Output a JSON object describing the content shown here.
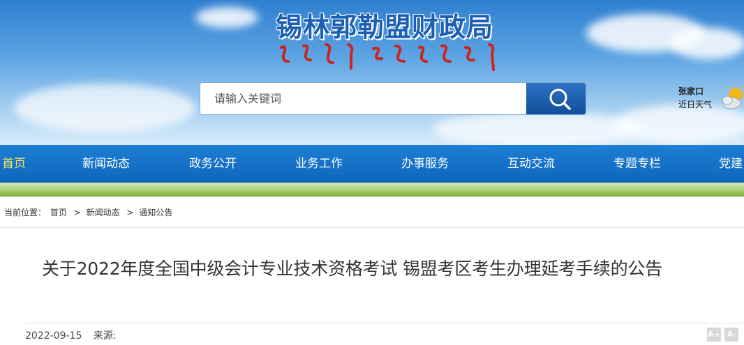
{
  "site": {
    "title": "锡林郭勒盟财政局"
  },
  "search": {
    "placeholder": "请输入关键词"
  },
  "weather": {
    "city": "张家口",
    "label": "近日天气",
    "icon": "partly-cloudy-icon"
  },
  "nav": {
    "items": [
      {
        "label": "首页",
        "active": true
      },
      {
        "label": "新闻动态"
      },
      {
        "label": "政务公开"
      },
      {
        "label": "业务工作"
      },
      {
        "label": "办事服务"
      },
      {
        "label": "互动交流"
      },
      {
        "label": "专题专栏"
      },
      {
        "label": "党建"
      }
    ]
  },
  "breadcrumb": {
    "prefix": "当前位置：",
    "items": [
      "首页",
      "新闻动态",
      "通知公告"
    ],
    "separator": ">"
  },
  "article": {
    "title": "关于2022年度全国中级会计专业技术资格考试 锡盟考区考生办理延考手续的公告",
    "date": "2022-09-15",
    "source_label": "来源:",
    "font_increase": "A+",
    "font_decrease": "A-"
  },
  "colors": {
    "nav_bg": "#0d66bd",
    "active_nav": "#ffe55a",
    "title_blue": "#1a5fb4"
  }
}
